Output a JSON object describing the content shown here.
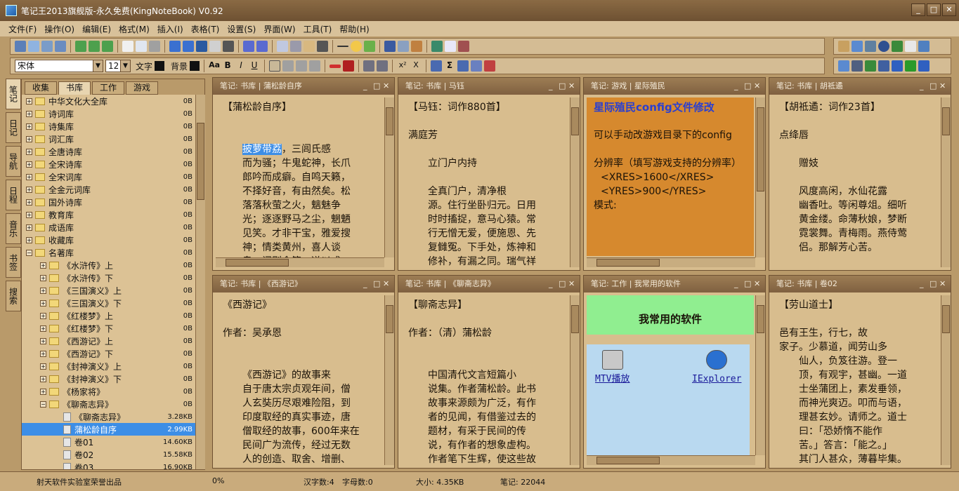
{
  "window": {
    "title": "笔记王2013旗舰版-永久免费(KingNoteBook) V0.92"
  },
  "menu": [
    "文件(F)",
    "操作(O)",
    "编辑(E)",
    "格式(M)",
    "插入(I)",
    "表格(T)",
    "设置(S)",
    "界面(W)",
    "工具(T)",
    "帮助(H)"
  ],
  "format": {
    "font": "宋体",
    "size": "12",
    "text_color_label": "文字",
    "bg_color_label": "背景",
    "text_color": "#111111",
    "bg_color": "#111111"
  },
  "vtabs": [
    "笔记",
    "日记",
    "导航",
    "日程",
    "音乐",
    "书签",
    "搜索"
  ],
  "htabs": [
    "收集",
    "书库",
    "工作",
    "游戏"
  ],
  "tree": [
    {
      "label": "中华文化大全库",
      "size": "0B"
    },
    {
      "label": "诗词库",
      "size": "0B"
    },
    {
      "label": "诗集库",
      "size": "0B"
    },
    {
      "label": "词汇库",
      "size": "0B"
    },
    {
      "label": "全唐诗库",
      "size": "0B"
    },
    {
      "label": "全宋诗库",
      "size": "0B"
    },
    {
      "label": "全宋词库",
      "size": "0B"
    },
    {
      "label": "全金元词库",
      "size": "0B"
    },
    {
      "label": "国外诗库",
      "size": "0B"
    },
    {
      "label": "教育库",
      "size": "0B"
    },
    {
      "label": "成语库",
      "size": "0B"
    },
    {
      "label": "收藏库",
      "size": "0B"
    },
    {
      "label": "名著库",
      "size": "0B"
    },
    {
      "label": "《水浒传》上",
      "size": "0B"
    },
    {
      "label": "《水浒传》下",
      "size": "0B"
    },
    {
      "label": "《三国演义》上",
      "size": "0B"
    },
    {
      "label": "《三国演义》下",
      "size": "0B"
    },
    {
      "label": "《红楼梦》上",
      "size": "0B"
    },
    {
      "label": "《红楼梦》下",
      "size": "0B"
    },
    {
      "label": "《西游记》上",
      "size": "0B"
    },
    {
      "label": "《西游记》下",
      "size": "0B"
    },
    {
      "label": "《封神演义》上",
      "size": "0B"
    },
    {
      "label": "《封神演义》下",
      "size": "0B"
    },
    {
      "label": "《杨家将》",
      "size": "0B"
    },
    {
      "label": "《聊斋志异》",
      "size": "0B"
    },
    {
      "label": "《聊斋志异》",
      "size": "3.28KB"
    },
    {
      "label": "蒲松龄自序",
      "size": "2.99KB"
    },
    {
      "label": "卷01",
      "size": "14.60KB"
    },
    {
      "label": "卷02",
      "size": "15.58KB"
    },
    {
      "label": "卷03",
      "size": "16.90KB"
    }
  ],
  "panes": [
    {
      "header": "笔记: 书库 | 蒲松龄自序",
      "lines": [
        "【蒲松龄自序】",
        "",
        "",
        "披萝带荔，三闾氏感",
        "而为骚；牛鬼蛇神，长爪",
        "郎吟而成癖。自鸣天籁，",
        "不择好音，有由然矣。松",
        "落落秋萤之火，魑魅争",
        "光；逐逐野马之尘，魍魉",
        "见笑。才非干宝，雅爱搜",
        "神；情类黄州，喜人谈",
        "鬼。闻则命笔，遂以成"
      ]
    },
    {
      "header": "笔记: 书库 | 马钰",
      "lines": [
        "【马钰：词作880首】",
        "",
        "满庭芳",
        "",
        "立门户内持",
        "",
        "全真门户，清净根",
        "源。住行坐卧归元。日用",
        "时时搐捉，意马心猿。常",
        "行无憎无爱，便施恩、先",
        "复雠冤。下手处，炼神和",
        "修补，有漏之同。瑞气祥"
      ]
    },
    {
      "header": "笔记: 游戏 | 星际殖民",
      "lines": [
        "星际殖民config文件修改",
        "",
        "可以手动改游戏目录下的config",
        "",
        "分辨率（填写游戏支持的分辨率）",
        "<XRES>1600</XRES>",
        "<YRES>900</YRES>",
        "模式:"
      ]
    },
    {
      "header": "笔记: 书库 | 胡祗遹",
      "lines": [
        "【胡祗遹：词作23首】",
        "",
        "点绛唇",
        "",
        "赠妓",
        "",
        "风度高闲，水仙花露",
        "幽香吐。等闲尊俎。细听",
        "黄金缕。命薄秋娘，梦断",
        "霓裳舞。青梅雨。燕侍莺",
        "侣。那解芳心苦。"
      ]
    },
    {
      "header": "笔记: 书库 | 《西游记》",
      "lines": [
        "《西游记》",
        "",
        "作者：吴承恩",
        "",
        "",
        "《西游记》的故事来",
        "自于唐太宗贞观年间，僧",
        "人玄奘历尽艰难险阻，到",
        "印度取经的真实事迹，唐",
        "僧取经的故事，600年来在",
        "民间广为流传，经过无数",
        "人的创造、取舍、增删、"
      ]
    },
    {
      "header": "笔记: 书库 | 《聊斋志异》",
      "lines": [
        "【聊斋志异】",
        "",
        "作者：（清）蒲松龄",
        "",
        "",
        "中国清代文言短篇小",
        "说集。作者蒲松龄。此书",
        "故事来源颇为广泛，有作",
        "者的见闻，有借鉴过去的",
        "题材，有采于民间的传",
        "说，有作者的想象虚构。",
        "作者笔下生辉，使这些故"
      ]
    },
    {
      "header": "笔记: 工作 | 我常用的软件",
      "title": "我常用的软件",
      "items": [
        "MTV播放",
        "IExplorer"
      ]
    },
    {
      "header": "笔记: 书库 | 卷02",
      "lines": [
        "【劳山道士】",
        "",
        "邑有王生，行七，故",
        "家子。少慕道，闻劳山多",
        "仙人，负笈往游。登一",
        "顶，有观宇，甚幽。一道",
        "士坐蒲团上，素发垂领，",
        "而神光爽迈。叩而与语，",
        "理甚玄妙。请师之。道士",
        "曰：「恐娇惰不能作",
        "苦。」答言：「能之。」",
        "其门人甚众，薄暮毕集。"
      ]
    }
  ],
  "status": {
    "credit": "射天软件实验室荣誉出品",
    "progress": "0%",
    "chars": "汉字数:4",
    "letters": "字母数:0",
    "size": "大小: 4.35KB",
    "notes": "笔记: 22044"
  }
}
